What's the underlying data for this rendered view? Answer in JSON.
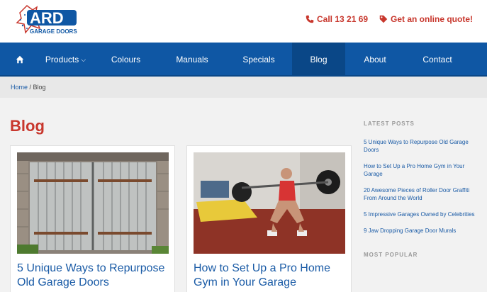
{
  "header": {
    "logo_text": "ARD",
    "logo_sub": "GARAGE DOORS",
    "phone_label": "Call 13 21 69",
    "quote_label": "Get an online quote!",
    "icons": {
      "phone": "phone-icon",
      "quote": "tag-icon"
    }
  },
  "nav": {
    "home_icon": "home-icon",
    "items": [
      {
        "label": "Products"
      },
      {
        "label": "Colours"
      },
      {
        "label": "Manuals"
      },
      {
        "label": "Specials"
      },
      {
        "label": "Blog"
      },
      {
        "label": "About"
      },
      {
        "label": "Contact"
      }
    ]
  },
  "breadcrumb": {
    "home": "Home",
    "separator": " / ",
    "current": "Blog"
  },
  "page": {
    "title": "Blog"
  },
  "posts": [
    {
      "title": "5 Unique Ways to Repurpose Old Garage Doors"
    },
    {
      "title": "How to Set Up a Pro Home Gym in Your Garage"
    }
  ],
  "sidebar": {
    "latest_heading": "LATEST POSTS",
    "latest": [
      "5 Unique Ways to Repurpose Old Garage Doors",
      "How to Set Up a Pro Home Gym in Your Garage",
      "20 Awesome Pieces of Roller Door Graffiti From Around the World",
      "5 Impressive Garages Owned by Celebrities",
      "9 Jaw Dropping Garage Door Murals"
    ],
    "popular_heading": "MOST POPULAR"
  },
  "colors": {
    "brand_red": "#c8372d",
    "nav_blue": "#0f57a4",
    "link_blue": "#1a5ba6"
  }
}
